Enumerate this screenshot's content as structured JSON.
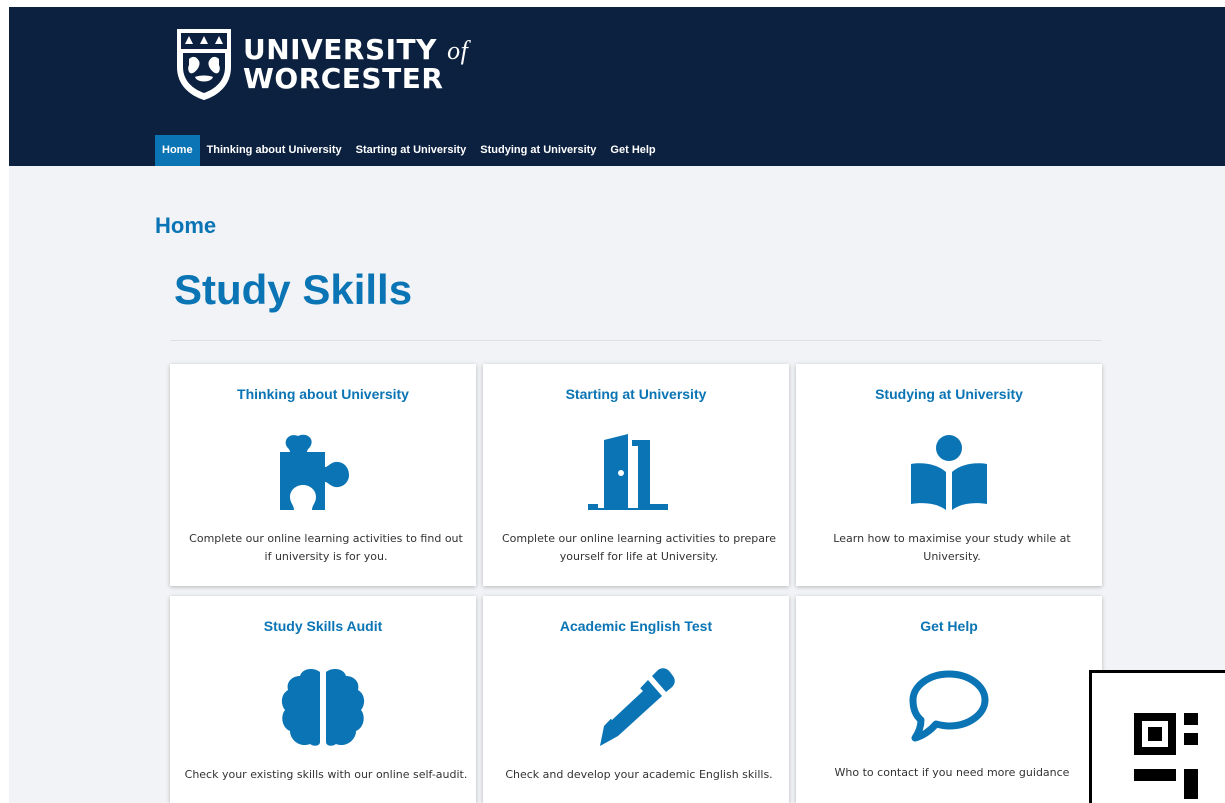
{
  "brand": {
    "name_line1": "UNIVERSITY",
    "name_of": "of",
    "name_line2": "WORCESTER",
    "header_color": "#0c2140",
    "accent_color": "#0a74b4",
    "crest_icon": "university-crest-icon"
  },
  "nav": {
    "items": [
      {
        "label": "Home",
        "active": true
      },
      {
        "label": "Thinking about University",
        "active": false
      },
      {
        "label": "Starting at University",
        "active": false
      },
      {
        "label": "Studying at University",
        "active": false
      },
      {
        "label": "Get Help",
        "active": false
      }
    ]
  },
  "page": {
    "breadcrumb": "Home",
    "title": "Study Skills"
  },
  "cards": [
    {
      "title": "Thinking about University",
      "icon": "puzzle-piece-icon",
      "description": "Complete our online learning activities to find out if university is for you."
    },
    {
      "title": "Starting at University",
      "icon": "door-icon",
      "description": "Complete our online learning activities to prepare yourself for life at University."
    },
    {
      "title": "Studying at University",
      "icon": "reader-icon",
      "description": "Learn how to maximise your study while at University."
    },
    {
      "title": "Study Skills Audit",
      "icon": "brain-icon",
      "description": "Check your existing skills with our online self-audit."
    },
    {
      "title": "Academic English Test",
      "icon": "pencil-icon",
      "description": "Check and develop your academic English skills."
    },
    {
      "title": "Get Help",
      "icon": "speech-bubble-icon",
      "description": "Who to contact if you need more guidance"
    }
  ]
}
